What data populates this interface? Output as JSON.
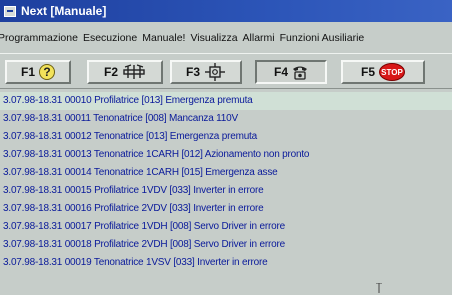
{
  "window": {
    "title": "Next [Manuale]"
  },
  "menu": [
    "Programmazione",
    "Esecuzione",
    "Manuale!",
    "Visualizza",
    "Allarmi",
    "Funzioni Ausiliarie"
  ],
  "toolbar": {
    "keys": [
      {
        "label": "F1",
        "icon": "help-icon"
      },
      {
        "label": "F2",
        "icon": "machine-icon"
      },
      {
        "label": "F3",
        "icon": "tool-icon"
      },
      {
        "label": "F4",
        "icon": "phone-icon"
      },
      {
        "label": "F5",
        "icon": "stop-icon",
        "icon_text": "STOP"
      }
    ],
    "pressed_key": "F4"
  },
  "log": [
    "3.07.98-18.31 00010 Profilatrice [013] Emergenza premuta",
    "3.07.98-18.31 00011 Tenonatrice [008] Mancanza 110V",
    "3.07.98-18.31 00012 Tenonatrice [013] Emergenza premuta",
    "3.07.98-18.31 00013 Tenonatrice 1CARH [012] Azionamento non pronto",
    "3.07.98-18.31 00014 Tenonatrice 1CARH [015] Emergenza asse",
    "3.07.98-18.31 00015 Profilatrice 1VDV [033] Inverter in errore",
    "3.07.98-18.31 00016 Profilatrice 2VDV [033] Inverter in errore",
    "3.07.98-18.31 00017 Profilatrice 1VDH [008] Servo Driver in errore",
    "3.07.98-18.31 00018 Profilatrice 2VDH [008] Servo Driver in errore",
    "3.07.98-18.31 00019 Tenonatrice 1VSV [033] Inverter in errore"
  ],
  "colors": {
    "titlebar": "#2c55b8",
    "log_text": "#0a1a9a",
    "stop_red": "#d81818"
  }
}
